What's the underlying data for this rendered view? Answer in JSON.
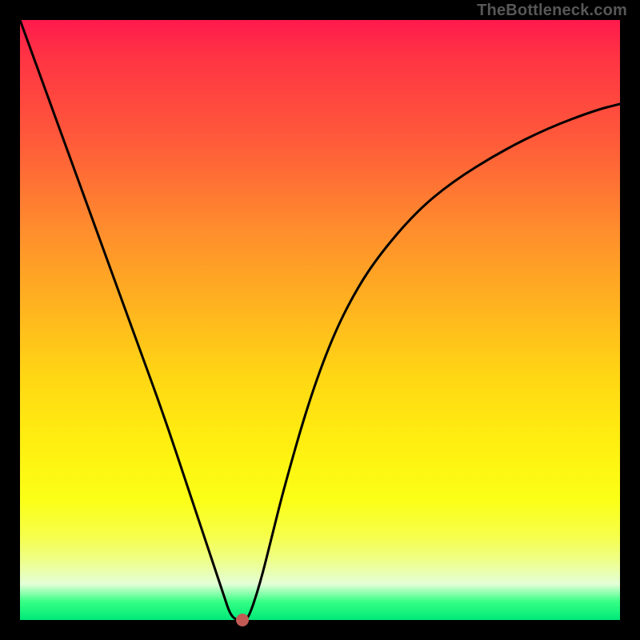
{
  "watermark": "TheBottleneck.com",
  "chart_data": {
    "type": "line",
    "title": "",
    "xlabel": "",
    "ylabel": "",
    "xlim": [
      0,
      100
    ],
    "ylim": [
      0,
      100
    ],
    "grid": false,
    "legend": false,
    "series": [
      {
        "name": "bottleneck-curve",
        "x": [
          0,
          4,
          8,
          12,
          16,
          20,
          24,
          28,
          30,
          32,
          34,
          35,
          36,
          37,
          38,
          40,
          42,
          44,
          48,
          52,
          56,
          60,
          66,
          72,
          80,
          88,
          96,
          100
        ],
        "y": [
          100,
          89,
          78,
          67,
          56,
          45,
          34,
          22,
          16,
          10,
          4,
          1,
          0,
          0,
          0,
          6,
          14,
          22,
          36,
          47,
          55,
          61,
          68,
          73,
          78,
          82,
          85,
          86
        ]
      }
    ],
    "marker": {
      "x": 37,
      "y": 0,
      "color": "#c35a54"
    },
    "background_gradient": {
      "top": "#ff1a4d",
      "mid": "#ffee10",
      "bottom": "#00e878"
    },
    "frame_color": "#000000",
    "curve_color": "#000000"
  }
}
